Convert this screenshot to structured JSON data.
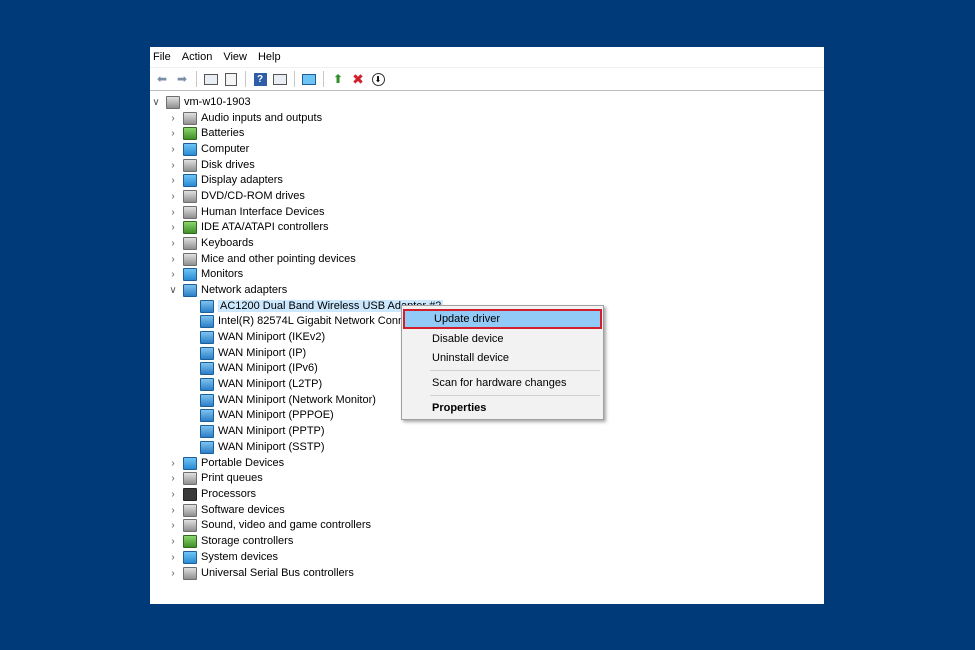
{
  "menu": [
    "File",
    "Action",
    "View",
    "Help"
  ],
  "toolbar": {
    "icons": [
      "back-icon",
      "forward-icon",
      "show-hide-tree-icon",
      "properties-icon",
      "help-icon",
      "action-pane-icon",
      "monitor-icon",
      "update-driver-icon",
      "uninstall-icon",
      "scan-hardware-icon"
    ],
    "colors": {
      "uninstall": "#d21f2b",
      "update": "#2f8f2a"
    }
  },
  "tree": {
    "root": "vm-w10-1903",
    "categories": [
      "Audio inputs and outputs",
      "Batteries",
      "Computer",
      "Disk drives",
      "Display adapters",
      "DVD/CD-ROM drives",
      "Human Interface Devices",
      "IDE ATA/ATAPI controllers",
      "Keyboards",
      "Mice and other pointing devices",
      "Monitors",
      "Network adapters"
    ],
    "network_adapters": [
      "AC1200  Dual Band Wireless USB Adapter #2",
      "Intel(R) 82574L Gigabit Network Connection",
      "WAN Miniport (IKEv2)",
      "WAN Miniport (IP)",
      "WAN Miniport (IPv6)",
      "WAN Miniport (L2TP)",
      "WAN Miniport (Network Monitor)",
      "WAN Miniport (PPPOE)",
      "WAN Miniport (PPTP)",
      "WAN Miniport (SSTP)"
    ],
    "categories_after": [
      "Portable Devices",
      "Print queues",
      "Processors",
      "Software devices",
      "Sound, video and game controllers",
      "Storage controllers",
      "System devices",
      "Universal Serial Bus controllers"
    ]
  },
  "context_menu": {
    "update_driver": "Update driver",
    "disable_device": "Disable device",
    "uninstall_device": "Uninstall device",
    "scan_hardware": "Scan for hardware changes",
    "properties": "Properties",
    "highlight_color": "#91c9f7",
    "outline_color": "#d21f2b"
  },
  "colors": {
    "background": "#003a78",
    "selection": "#cce8ff"
  }
}
